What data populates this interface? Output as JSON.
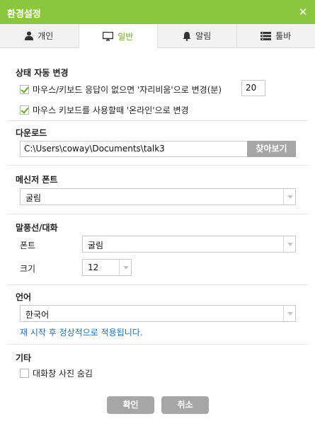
{
  "window": {
    "title": "환경설정",
    "close_symbol": "✕"
  },
  "tabs": [
    {
      "label": "개인",
      "icon": "person-icon",
      "active": false
    },
    {
      "label": "일반",
      "icon": "monitor-icon",
      "active": true
    },
    {
      "label": "알림",
      "icon": "bell-icon",
      "active": false
    },
    {
      "label": "툴바",
      "icon": "toolbar-icon",
      "active": false
    }
  ],
  "status_section": {
    "title": "상태 자동 변경",
    "away_option": {
      "label": "마우스/키보드 응답이 없으면 '자리비움'으로 변경(분)",
      "checked": true,
      "minutes": "20"
    },
    "online_option": {
      "label": "마우스 키보드를 사용할때 '온라인'으로 변경",
      "checked": true
    }
  },
  "download_section": {
    "title": "다운로드",
    "path": "C:\\Users\\coway\\Documents\\talk3",
    "browse_label": "찾아보기"
  },
  "messenger_font_section": {
    "title": "메신저 폰트",
    "font": "굴림"
  },
  "bubble_section": {
    "title": "말풍선/대화",
    "font_label": "폰트",
    "font_value": "굴림",
    "size_label": "크기",
    "size_value": "12"
  },
  "language_section": {
    "title": "언어",
    "value": "한국어",
    "note": "재 시작 후 정상적으로 적용됩니다."
  },
  "etc_section": {
    "title": "기타",
    "hide_photo": {
      "label": "대화창 사진 숨김",
      "checked": false
    }
  },
  "buttons": {
    "ok": "확인",
    "cancel": "취소"
  },
  "colors": {
    "accent": "#8cc63f",
    "active_tab_text": "#6aa51f",
    "note_text": "#1f6fb8",
    "button_gray": "#a6a6a6"
  }
}
